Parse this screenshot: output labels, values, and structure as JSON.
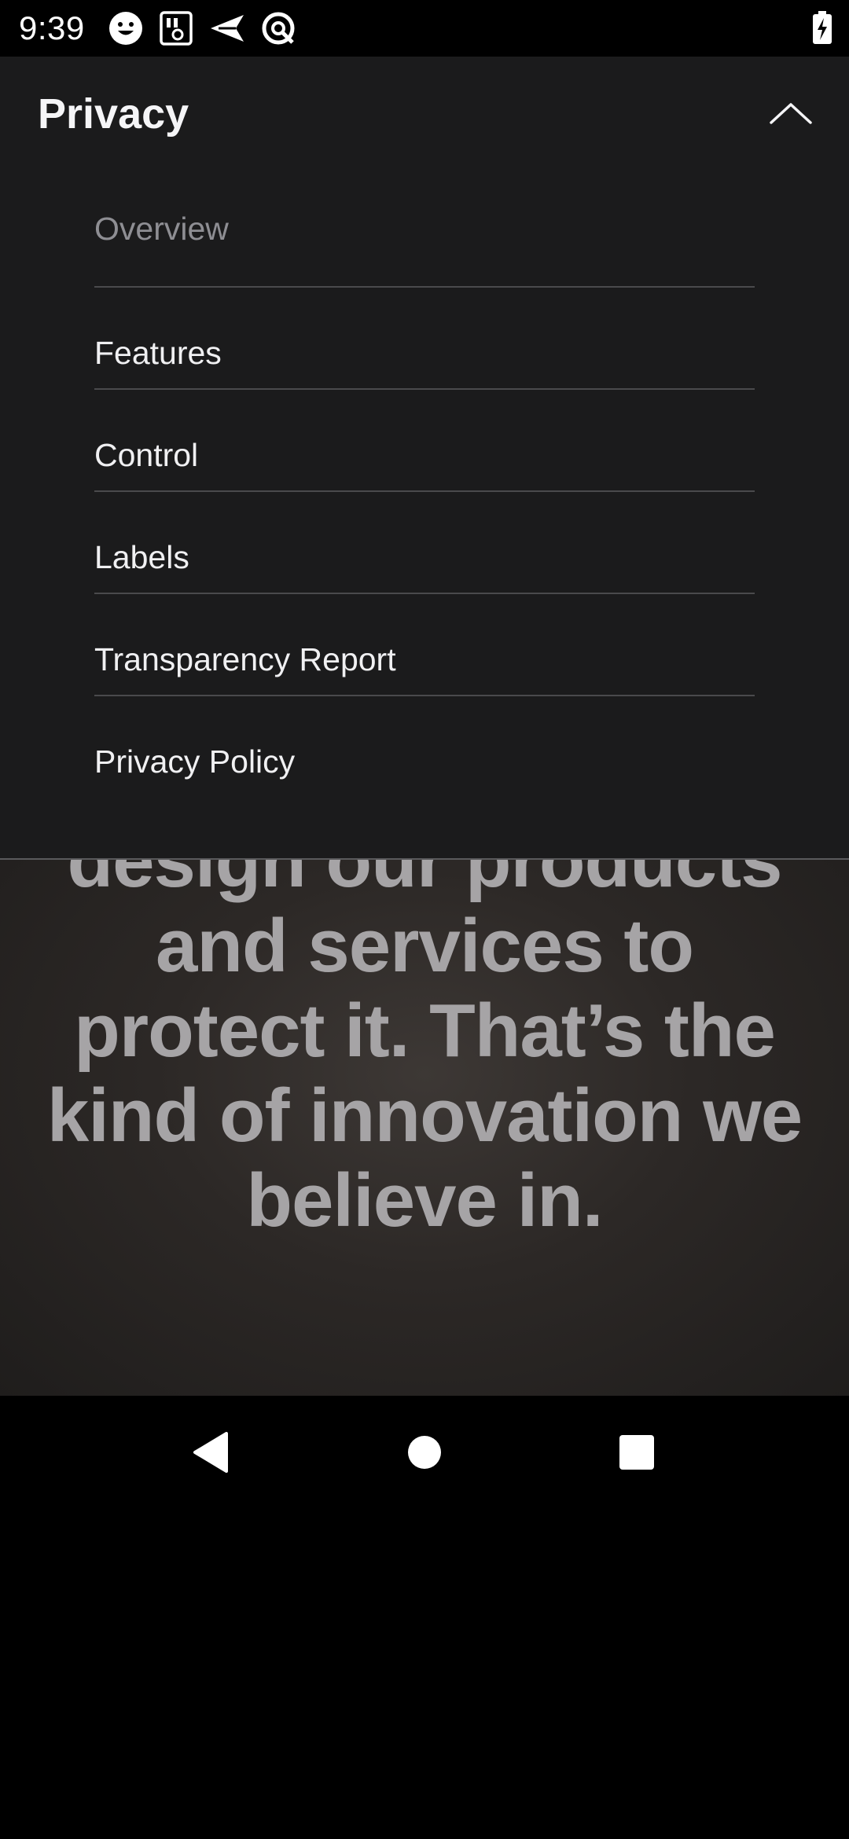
{
  "status_bar": {
    "time": "9:39",
    "icons": [
      "smiley-icon",
      "sim-card-icon",
      "send-icon",
      "no-data-icon"
    ],
    "battery": "battery-charging-icon"
  },
  "menu": {
    "title": "Privacy",
    "collapse_icon": "chevron-up-icon",
    "items": [
      {
        "label": "Overview",
        "current": true
      },
      {
        "label": "Features"
      },
      {
        "label": "Control"
      },
      {
        "label": "Labels"
      },
      {
        "label": "Transparency Report"
      },
      {
        "label": "Privacy Policy"
      }
    ]
  },
  "hero": {
    "lines": [
      "design our products",
      "and services to",
      "protect it. That’s the",
      "kind of innovation we",
      "believe in."
    ]
  },
  "nav_bar": {
    "back": "back-icon",
    "home": "home-icon",
    "recents": "recents-icon"
  },
  "colors": {
    "panel_bg": "#1b1b1c",
    "menu_text": "#f0f0f2",
    "current_item": "#8e8e93",
    "hero_text": "#a6a4a6"
  }
}
